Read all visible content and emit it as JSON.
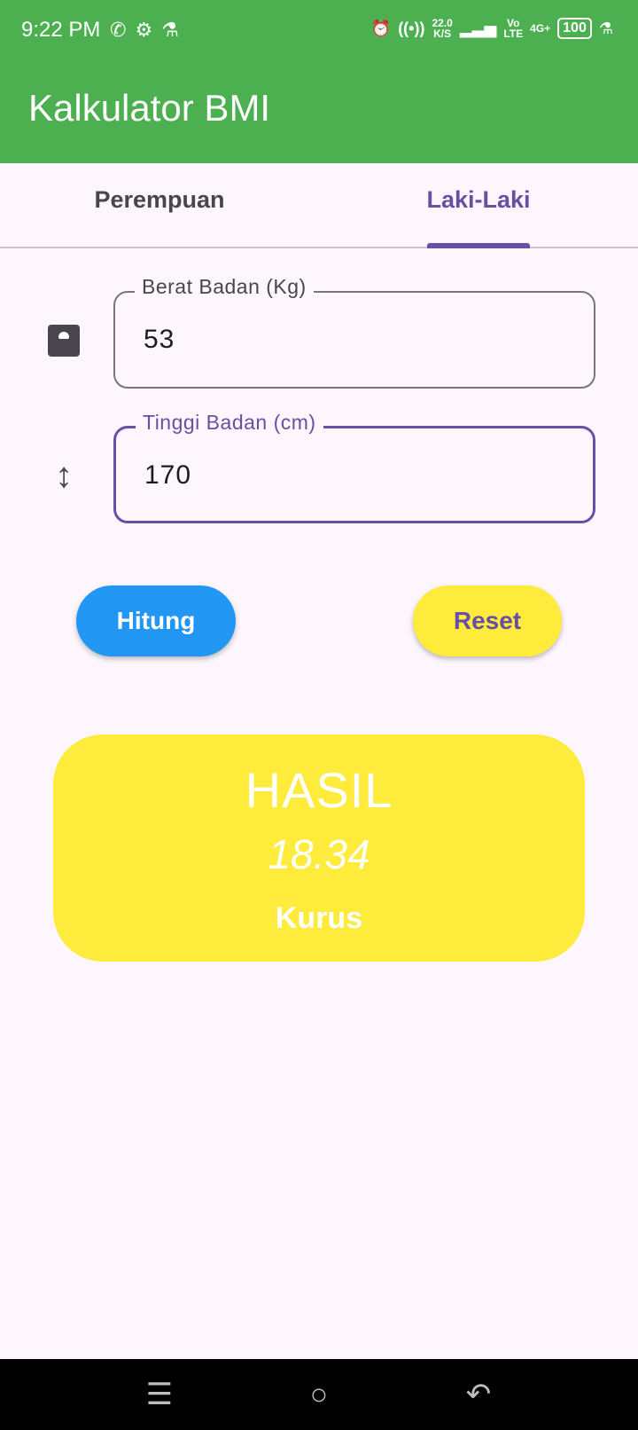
{
  "status_bar": {
    "time": "9:22 PM",
    "left_icons": [
      "whatsapp-icon",
      "settings-icon",
      "flask-icon"
    ],
    "net_speed_value": "22.0",
    "net_speed_unit": "K/S",
    "volte_top": "Vo",
    "volte_bottom": "LTE",
    "network": "4G+",
    "battery": "100"
  },
  "app_bar": {
    "title": "Kalkulator BMI"
  },
  "tabs": [
    {
      "label": "Perempuan",
      "selected": false
    },
    {
      "label": "Laki-Laki",
      "selected": true
    }
  ],
  "weight_field": {
    "label": "Berat Badan (Kg)",
    "value": "53",
    "icon": "scale-icon"
  },
  "height_field": {
    "label": "Tinggi Badan (cm)",
    "value": "170",
    "icon": "height-icon"
  },
  "buttons": {
    "calculate": "Hitung",
    "reset": "Reset"
  },
  "result": {
    "heading": "HASIL",
    "bmi": "18.34",
    "category": "Kurus"
  },
  "colors": {
    "app_bar": "#4caf50",
    "accent": "#6750a4",
    "calculate_button": "#2196f3",
    "reset_button": "#ffeb3b",
    "result_card": "#ffeb3b"
  },
  "nav_bar": [
    "menu-icon",
    "home-icon",
    "back-icon"
  ]
}
